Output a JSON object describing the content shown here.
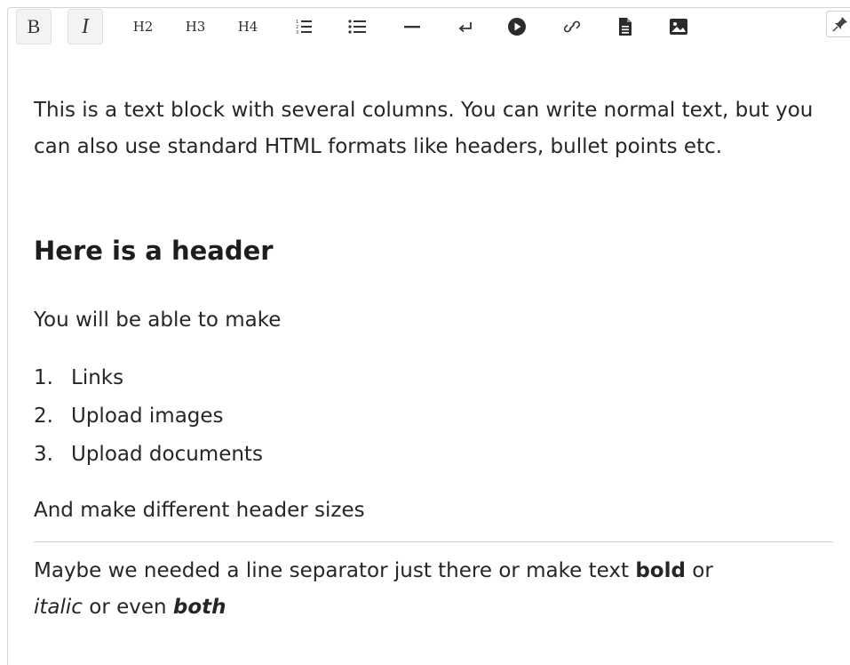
{
  "toolbar": {
    "bold_label": "B",
    "italic_label": "I",
    "h2_label": "H2",
    "h3_label": "H3",
    "h4_label": "H4",
    "icons": [
      "ordered-list-icon",
      "unordered-list-icon",
      "horizontal-rule-icon",
      "line-break-icon",
      "video-icon",
      "link-icon",
      "document-icon",
      "image-icon"
    ]
  },
  "content": {
    "intro": "This is a text block with several columns. You can write normal text, but you can also use standard HTML formats like headers, bullet points etc.",
    "header": "Here is a header",
    "lead": "You will be able to make",
    "list": [
      {
        "num": "1.",
        "text": "Links"
      },
      {
        "num": "2.",
        "text": "Upload images"
      },
      {
        "num": "3.",
        "text": "Upload documents"
      }
    ],
    "after_list": "And make different header sizes",
    "last_pre": "Maybe we needed a line separator just there or make text ",
    "last_bold": "bold",
    "last_mid1": " or",
    "last_italic": "italic",
    "last_mid2": " or even ",
    "last_both": "both"
  },
  "colors": {
    "text": "#262626",
    "active_button_bg": "#f3f3f3",
    "divider": "#d0d0d0"
  }
}
